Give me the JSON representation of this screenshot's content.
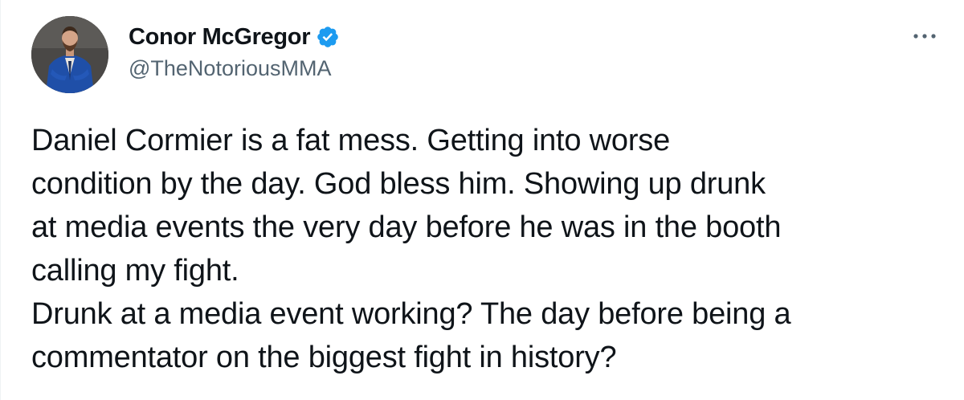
{
  "tweet": {
    "author": {
      "display_name": "Conor McGregor",
      "handle": "@TheNotoriousMMA",
      "verified": true,
      "avatar_icon": "avatar-photo"
    },
    "more_icon": "more-options-icon",
    "text": "Daniel Cormier is a fat mess. Getting into worse\ncondition by the day. God bless him. Showing up drunk\nat media events the very day before he was in the booth\ncalling my fight.\nDrunk at a media event working? The day before being a\ncommentator on the biggest fight in history?",
    "colors": {
      "text": "#0f1419",
      "secondary": "#536471",
      "verified_badge": "#1d9bf0"
    }
  }
}
